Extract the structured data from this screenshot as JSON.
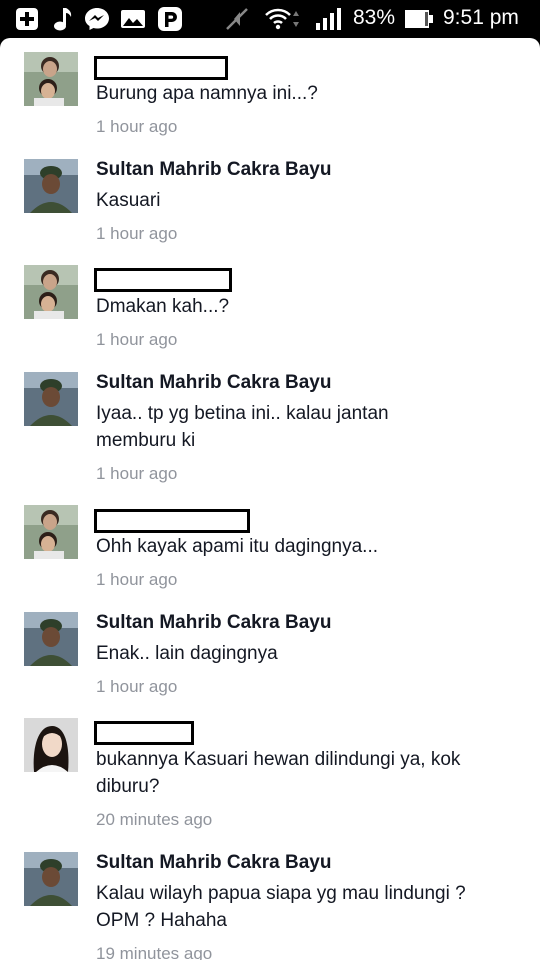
{
  "status_bar": {
    "icons": [
      "add-box-icon",
      "music-note-icon",
      "messenger-icon",
      "photo-icon",
      "p-app-icon",
      "mute-icon",
      "wifi-icon",
      "signal-icon",
      "battery-icon"
    ],
    "battery_percent": "83%",
    "time": "9:51 pm",
    "battery_level": 0.83
  },
  "comments": [
    {
      "name": "",
      "redacted": true,
      "text": "Burung apa namnya ini...?",
      "time": "1 hour ago",
      "avatar": "avatar-two-people"
    },
    {
      "name": "Sultan Mahrib Cakra Bayu",
      "redacted": false,
      "text": "Kasuari",
      "time": "1 hour ago",
      "avatar": "avatar-sultan"
    },
    {
      "name": "",
      "redacted": true,
      "text": "Dmakan kah...?",
      "time": "1 hour ago",
      "avatar": "avatar-two-people"
    },
    {
      "name": "Sultan Mahrib Cakra Bayu",
      "redacted": false,
      "text": "Iyaa.. tp yg betina ini.. kalau jantan memburu ki",
      "time": "1 hour ago",
      "avatar": "avatar-sultan"
    },
    {
      "name": "",
      "redacted": true,
      "text": "Ohh kayak apami itu dagingnya...",
      "time": "1 hour ago",
      "avatar": "avatar-two-people"
    },
    {
      "name": "Sultan Mahrib Cakra Bayu",
      "redacted": false,
      "text": "Enak.. lain dagingnya",
      "time": "1 hour ago",
      "avatar": "avatar-sultan"
    },
    {
      "name": "",
      "redacted": true,
      "text": "bukannya Kasuari hewan dilindungi ya, kok diburu?",
      "time": "20 minutes ago",
      "avatar": "avatar-girl"
    },
    {
      "name": "Sultan Mahrib Cakra Bayu",
      "redacted": false,
      "text": "Kalau wilayh papua siapa yg mau lindungi ? OPM ? Hahaha",
      "time": "19 minutes ago",
      "avatar": "avatar-sultan"
    }
  ]
}
